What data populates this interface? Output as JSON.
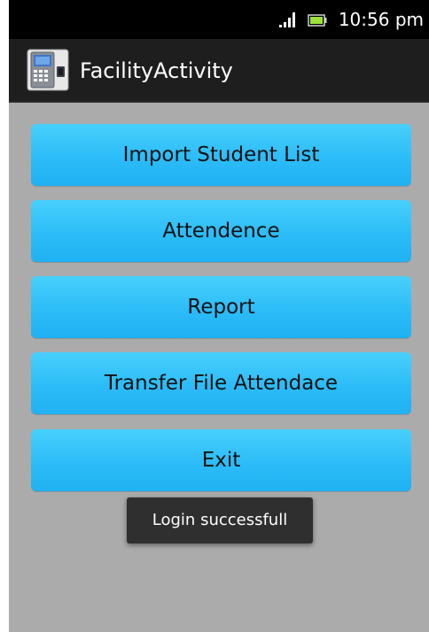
{
  "status_bar": {
    "time": "10:56 pm",
    "signal_icon": "signal-strength-icon",
    "battery_icon": "battery-icon"
  },
  "action_bar": {
    "title": "FacilityActivity",
    "app_icon": "fingerprint-terminal-icon"
  },
  "buttons": [
    {
      "label": "Import Student List"
    },
    {
      "label": "Attendence"
    },
    {
      "label": "Report"
    },
    {
      "label": "Transfer File Attendace"
    },
    {
      "label": "Exit"
    }
  ],
  "toast": {
    "message": "Login successfull"
  },
  "colors": {
    "background": "#ababab",
    "button": "#2cbcf8",
    "action_bar": "#1e1e1e",
    "status_bar": "#000000",
    "toast": "#2f2f2f"
  }
}
